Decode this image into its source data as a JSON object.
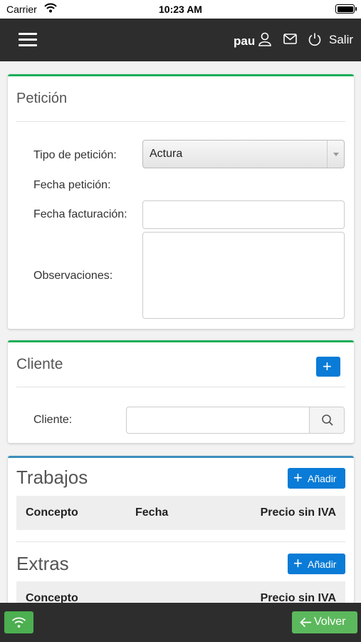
{
  "status_bar": {
    "carrier": "Carrier",
    "time": "10:23 AM"
  },
  "navbar": {
    "user": "pau",
    "logout_label": "Salir"
  },
  "peticion": {
    "title": "Petición",
    "tipo_label": "Tipo de petición:",
    "tipo_value": "Actura",
    "fecha_peticion_label": "Fecha petición:",
    "fecha_facturacion_label": "Fecha facturación:",
    "fecha_facturacion_value": "",
    "observaciones_label": "Observaciones:",
    "observaciones_value": ""
  },
  "cliente": {
    "title": "Cliente",
    "field_label": "Cliente:",
    "field_value": ""
  },
  "trabajos": {
    "title": "Trabajos",
    "add_label": "Añadir",
    "columns": [
      "Concepto",
      "Fecha",
      "Precio sin IVA"
    ]
  },
  "extras": {
    "title": "Extras",
    "add_label": "Añadir",
    "columns": [
      "Concepto",
      "Precio sin IVA"
    ]
  },
  "bottom": {
    "back_label": "Volver"
  },
  "colors": {
    "accent_green": "#1aae5a",
    "accent_blue": "#3c8dbc",
    "button_blue": "#0a7bd6",
    "dark_bar": "#2d2d2d"
  }
}
